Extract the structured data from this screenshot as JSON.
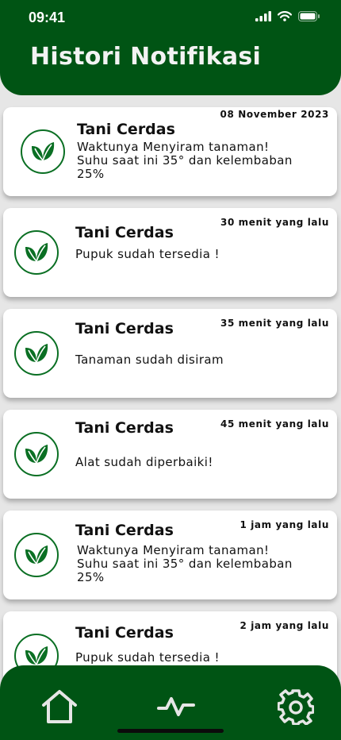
{
  "status_bar": {
    "time": "09:41"
  },
  "header": {
    "title": "Histori Notifikasi"
  },
  "notifications": [
    {
      "title": "Tani Cerdas",
      "time": "08 November 2023",
      "message": "Waktunya Menyiram tanaman!\nSuhu saat ini 35° dan kelembaban 25%"
    },
    {
      "title": "Tani Cerdas",
      "time": "30 menit yang lalu",
      "message": "Pupuk sudah tersedia !"
    },
    {
      "title": "Tani Cerdas",
      "time": "35 menit yang lalu",
      "message": "Tanaman sudah disiram"
    },
    {
      "title": "Tani Cerdas",
      "time": "45 menit yang lalu",
      "message": "Alat sudah diperbaiki!"
    },
    {
      "title": "Tani Cerdas",
      "time": "1 jam yang lalu",
      "message": "Waktunya Menyiram tanaman!\nSuhu saat ini 35° dan kelembaban 25%"
    },
    {
      "title": "Tani Cerdas",
      "time": "2 jam yang lalu",
      "message": "Pupuk sudah tersedia !"
    }
  ],
  "icons": {
    "notification": "leaf-icon",
    "nav_home": "home-icon",
    "nav_activity": "activity-icon",
    "nav_settings": "gear-icon"
  },
  "colors": {
    "brand": "#005414",
    "background": "#e6e6e6",
    "card": "#ffffff"
  }
}
